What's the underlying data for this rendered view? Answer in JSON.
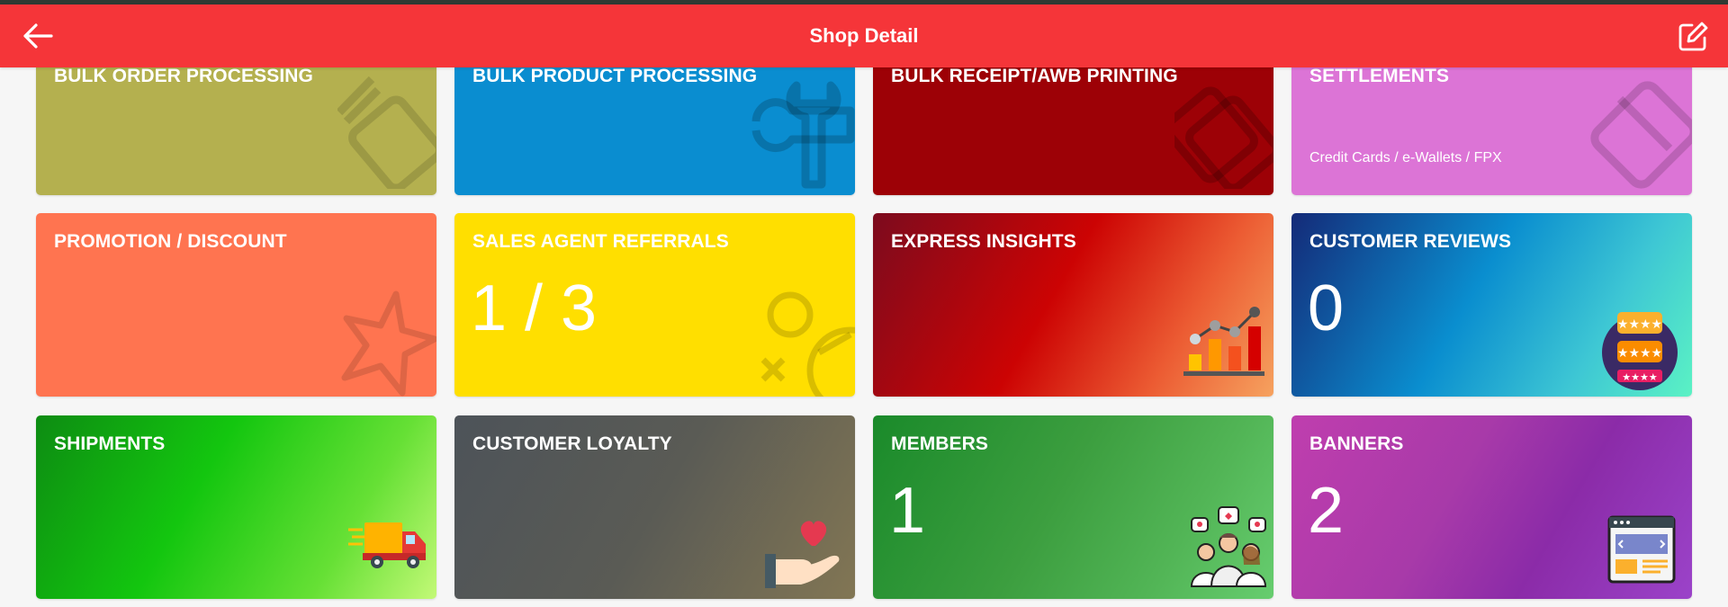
{
  "header": {
    "title": "Shop Detail",
    "back_icon": "arrow-left-icon",
    "edit_icon": "edit-square-icon",
    "color": "#f53539"
  },
  "tiles": {
    "bulk_order": {
      "label": "BULK ORDER PROCESSING",
      "icon": "cards-outline-icon",
      "color": "#b4b04f"
    },
    "bulk_product": {
      "label": "BULK PRODUCT PROCESSING",
      "icon": "tools-icon",
      "color": "#0a8dd0"
    },
    "bulk_receipt": {
      "label": "BULK RECEIPT/AWB PRINTING",
      "icon": "cards-outline-icon",
      "color": "#9d0106"
    },
    "settlements": {
      "label": "SETTLEMENTS",
      "sub": "Credit Cards / e-Wallets / FPX",
      "icon": "card-outline-icon",
      "color": "#dc74d6"
    },
    "promotion": {
      "label": "PROMOTION / DISCOUNT",
      "icon": "star-outline-icon",
      "color": "#ff7450"
    },
    "sales_agent": {
      "label": "SALES AGENT REFERRALS",
      "value": "1 / 3",
      "icon": "shapes-icon",
      "color": "#ffdf00"
    },
    "insights": {
      "label": "EXPRESS INSIGHTS",
      "icon": "bar-chart-icon"
    },
    "reviews": {
      "label": "CUSTOMER REVIEWS",
      "value": "0",
      "icon": "reviews-icon"
    },
    "shipments": {
      "label": "SHIPMENTS",
      "icon": "delivery-truck-icon"
    },
    "loyalty": {
      "label": "CUSTOMER LOYALTY",
      "icon": "heart-hand-icon"
    },
    "members": {
      "label": "MEMBERS",
      "value": "1",
      "icon": "members-group-icon"
    },
    "banners": {
      "label": "BANNERS",
      "value": "2",
      "icon": "browser-banner-icon"
    }
  }
}
